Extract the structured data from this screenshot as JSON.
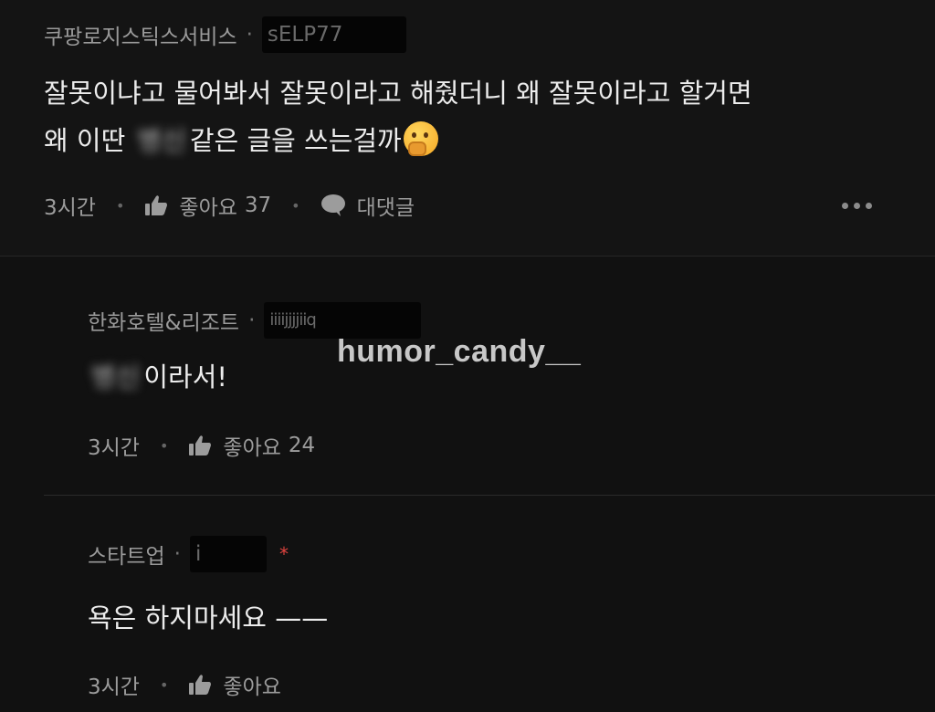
{
  "watermark": "humor_candy__",
  "comments": [
    {
      "author": "쿠팡로지스틱스서비스",
      "author_separator": "·",
      "masked_id": "sELP77",
      "text_line1": "잘못이냐고 물어봐서 잘못이라고 해줬더니 왜 잘못이라고 할거면",
      "text_line2_pre": "왜 이딴 ",
      "text_blurred": "병신",
      "text_line2_post": "같은 글을 쓰는걸까",
      "emoji": "thinking-face",
      "time": "3시간",
      "like_label": "좋아요",
      "like_count": "37",
      "reply_label": "대댓글"
    },
    {
      "author": "한화호텔&리조트",
      "author_separator": "·",
      "masked_id": "iiiijjjjiiq",
      "text_blurred": "병신",
      "text_post": "이라서!",
      "time": "3시간",
      "like_label": "좋아요",
      "like_count": "24"
    },
    {
      "author": "스타트업",
      "author_separator": "·",
      "masked_id": "i",
      "badge": "*",
      "text": "욕은 하지마세요 ——",
      "time": "3시간",
      "like_label": "좋아요"
    }
  ],
  "colors": {
    "background": "#111111",
    "text": "#ececec",
    "meta": "#9a9a9a",
    "badge_red": "#e0433f"
  }
}
